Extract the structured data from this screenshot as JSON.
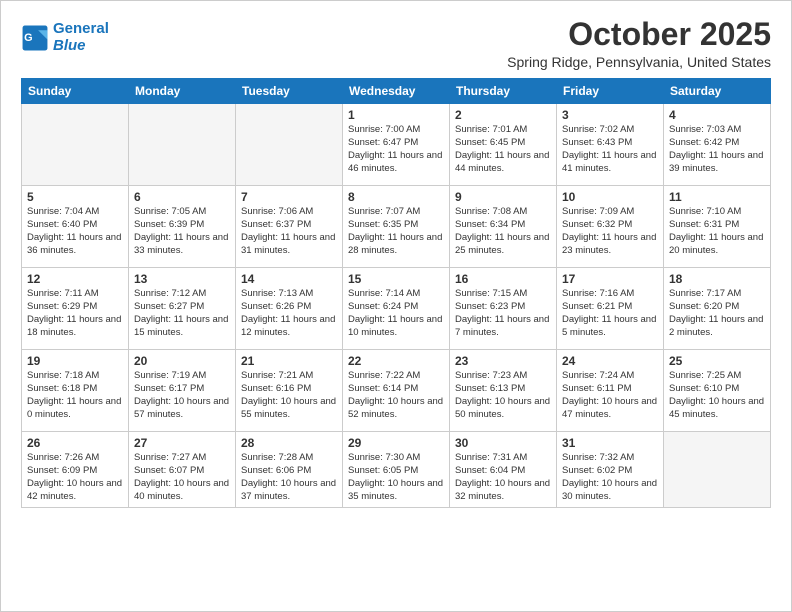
{
  "header": {
    "logo_line1": "General",
    "logo_line2": "Blue",
    "month_title": "October 2025",
    "location": "Spring Ridge, Pennsylvania, United States"
  },
  "weekdays": [
    "Sunday",
    "Monday",
    "Tuesday",
    "Wednesday",
    "Thursday",
    "Friday",
    "Saturday"
  ],
  "weeks": [
    [
      {
        "day": "",
        "info": ""
      },
      {
        "day": "",
        "info": ""
      },
      {
        "day": "",
        "info": ""
      },
      {
        "day": "1",
        "info": "Sunrise: 7:00 AM\nSunset: 6:47 PM\nDaylight: 11 hours\nand 46 minutes."
      },
      {
        "day": "2",
        "info": "Sunrise: 7:01 AM\nSunset: 6:45 PM\nDaylight: 11 hours\nand 44 minutes."
      },
      {
        "day": "3",
        "info": "Sunrise: 7:02 AM\nSunset: 6:43 PM\nDaylight: 11 hours\nand 41 minutes."
      },
      {
        "day": "4",
        "info": "Sunrise: 7:03 AM\nSunset: 6:42 PM\nDaylight: 11 hours\nand 39 minutes."
      }
    ],
    [
      {
        "day": "5",
        "info": "Sunrise: 7:04 AM\nSunset: 6:40 PM\nDaylight: 11 hours\nand 36 minutes."
      },
      {
        "day": "6",
        "info": "Sunrise: 7:05 AM\nSunset: 6:39 PM\nDaylight: 11 hours\nand 33 minutes."
      },
      {
        "day": "7",
        "info": "Sunrise: 7:06 AM\nSunset: 6:37 PM\nDaylight: 11 hours\nand 31 minutes."
      },
      {
        "day": "8",
        "info": "Sunrise: 7:07 AM\nSunset: 6:35 PM\nDaylight: 11 hours\nand 28 minutes."
      },
      {
        "day": "9",
        "info": "Sunrise: 7:08 AM\nSunset: 6:34 PM\nDaylight: 11 hours\nand 25 minutes."
      },
      {
        "day": "10",
        "info": "Sunrise: 7:09 AM\nSunset: 6:32 PM\nDaylight: 11 hours\nand 23 minutes."
      },
      {
        "day": "11",
        "info": "Sunrise: 7:10 AM\nSunset: 6:31 PM\nDaylight: 11 hours\nand 20 minutes."
      }
    ],
    [
      {
        "day": "12",
        "info": "Sunrise: 7:11 AM\nSunset: 6:29 PM\nDaylight: 11 hours\nand 18 minutes."
      },
      {
        "day": "13",
        "info": "Sunrise: 7:12 AM\nSunset: 6:27 PM\nDaylight: 11 hours\nand 15 minutes."
      },
      {
        "day": "14",
        "info": "Sunrise: 7:13 AM\nSunset: 6:26 PM\nDaylight: 11 hours\nand 12 minutes."
      },
      {
        "day": "15",
        "info": "Sunrise: 7:14 AM\nSunset: 6:24 PM\nDaylight: 11 hours\nand 10 minutes."
      },
      {
        "day": "16",
        "info": "Sunrise: 7:15 AM\nSunset: 6:23 PM\nDaylight: 11 hours\nand 7 minutes."
      },
      {
        "day": "17",
        "info": "Sunrise: 7:16 AM\nSunset: 6:21 PM\nDaylight: 11 hours\nand 5 minutes."
      },
      {
        "day": "18",
        "info": "Sunrise: 7:17 AM\nSunset: 6:20 PM\nDaylight: 11 hours\nand 2 minutes."
      }
    ],
    [
      {
        "day": "19",
        "info": "Sunrise: 7:18 AM\nSunset: 6:18 PM\nDaylight: 11 hours\nand 0 minutes."
      },
      {
        "day": "20",
        "info": "Sunrise: 7:19 AM\nSunset: 6:17 PM\nDaylight: 10 hours\nand 57 minutes."
      },
      {
        "day": "21",
        "info": "Sunrise: 7:21 AM\nSunset: 6:16 PM\nDaylight: 10 hours\nand 55 minutes."
      },
      {
        "day": "22",
        "info": "Sunrise: 7:22 AM\nSunset: 6:14 PM\nDaylight: 10 hours\nand 52 minutes."
      },
      {
        "day": "23",
        "info": "Sunrise: 7:23 AM\nSunset: 6:13 PM\nDaylight: 10 hours\nand 50 minutes."
      },
      {
        "day": "24",
        "info": "Sunrise: 7:24 AM\nSunset: 6:11 PM\nDaylight: 10 hours\nand 47 minutes."
      },
      {
        "day": "25",
        "info": "Sunrise: 7:25 AM\nSunset: 6:10 PM\nDaylight: 10 hours\nand 45 minutes."
      }
    ],
    [
      {
        "day": "26",
        "info": "Sunrise: 7:26 AM\nSunset: 6:09 PM\nDaylight: 10 hours\nand 42 minutes."
      },
      {
        "day": "27",
        "info": "Sunrise: 7:27 AM\nSunset: 6:07 PM\nDaylight: 10 hours\nand 40 minutes."
      },
      {
        "day": "28",
        "info": "Sunrise: 7:28 AM\nSunset: 6:06 PM\nDaylight: 10 hours\nand 37 minutes."
      },
      {
        "day": "29",
        "info": "Sunrise: 7:30 AM\nSunset: 6:05 PM\nDaylight: 10 hours\nand 35 minutes."
      },
      {
        "day": "30",
        "info": "Sunrise: 7:31 AM\nSunset: 6:04 PM\nDaylight: 10 hours\nand 32 minutes."
      },
      {
        "day": "31",
        "info": "Sunrise: 7:32 AM\nSunset: 6:02 PM\nDaylight: 10 hours\nand 30 minutes."
      },
      {
        "day": "",
        "info": ""
      }
    ]
  ]
}
